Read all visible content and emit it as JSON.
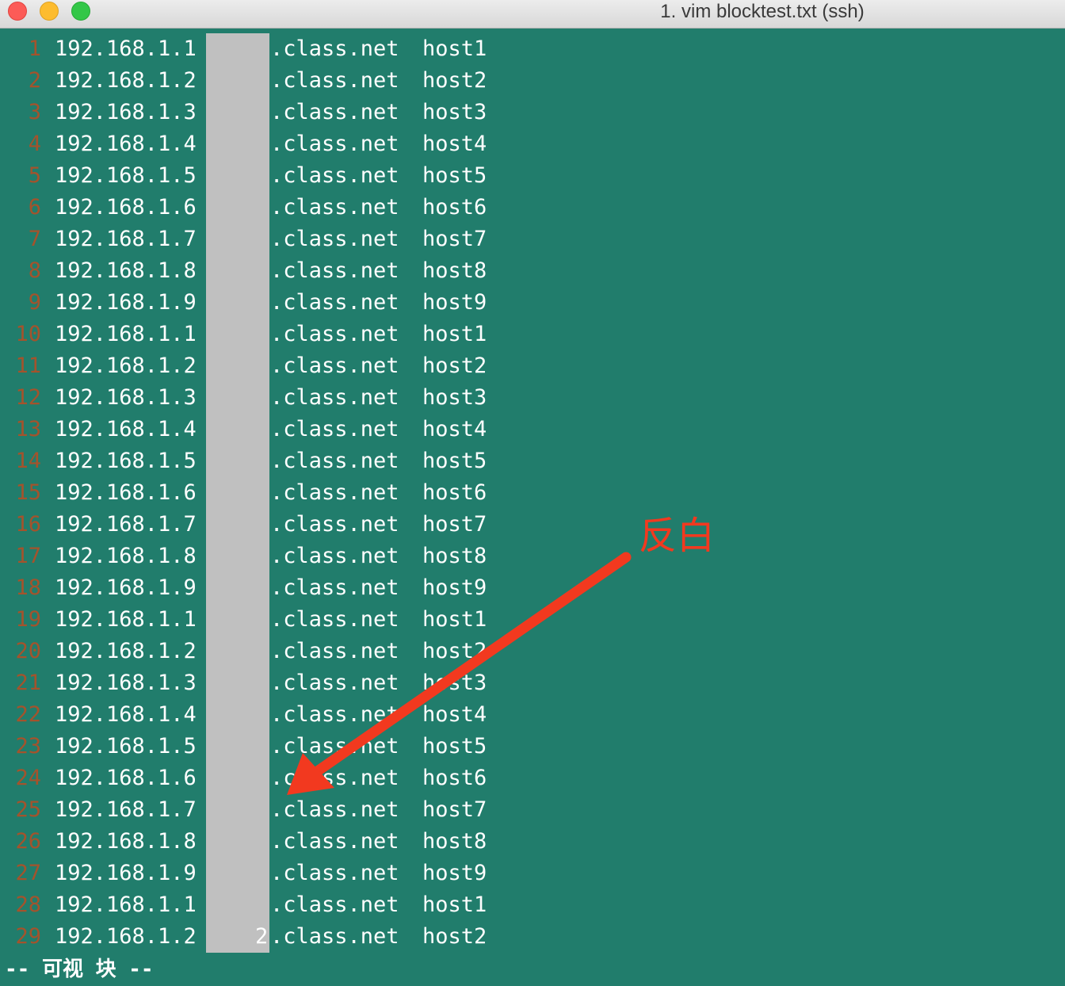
{
  "window": {
    "title": "1. vim blocktest.txt (ssh)"
  },
  "lines": [
    {
      "n": "1",
      "ip": "192.168.1.1",
      "domain": ".class.net",
      "host": "host1"
    },
    {
      "n": "2",
      "ip": "192.168.1.2",
      "domain": ".class.net",
      "host": "host2"
    },
    {
      "n": "3",
      "ip": "192.168.1.3",
      "domain": ".class.net",
      "host": "host3"
    },
    {
      "n": "4",
      "ip": "192.168.1.4",
      "domain": ".class.net",
      "host": "host4"
    },
    {
      "n": "5",
      "ip": "192.168.1.5",
      "domain": ".class.net",
      "host": "host5"
    },
    {
      "n": "6",
      "ip": "192.168.1.6",
      "domain": ".class.net",
      "host": "host6"
    },
    {
      "n": "7",
      "ip": "192.168.1.7",
      "domain": ".class.net",
      "host": "host7"
    },
    {
      "n": "8",
      "ip": "192.168.1.8",
      "domain": ".class.net",
      "host": "host8"
    },
    {
      "n": "9",
      "ip": "192.168.1.9",
      "domain": ".class.net",
      "host": "host9"
    },
    {
      "n": "10",
      "ip": "192.168.1.1",
      "domain": ".class.net",
      "host": "host1"
    },
    {
      "n": "11",
      "ip": "192.168.1.2",
      "domain": ".class.net",
      "host": "host2"
    },
    {
      "n": "12",
      "ip": "192.168.1.3",
      "domain": ".class.net",
      "host": "host3"
    },
    {
      "n": "13",
      "ip": "192.168.1.4",
      "domain": ".class.net",
      "host": "host4"
    },
    {
      "n": "14",
      "ip": "192.168.1.5",
      "domain": ".class.net",
      "host": "host5"
    },
    {
      "n": "15",
      "ip": "192.168.1.6",
      "domain": ".class.net",
      "host": "host6"
    },
    {
      "n": "16",
      "ip": "192.168.1.7",
      "domain": ".class.net",
      "host": "host7"
    },
    {
      "n": "17",
      "ip": "192.168.1.8",
      "domain": ".class.net",
      "host": "host8"
    },
    {
      "n": "18",
      "ip": "192.168.1.9",
      "domain": ".class.net",
      "host": "host9"
    },
    {
      "n": "19",
      "ip": "192.168.1.1",
      "domain": ".class.net",
      "host": "host1"
    },
    {
      "n": "20",
      "ip": "192.168.1.2",
      "domain": ".class.net",
      "host": "host2"
    },
    {
      "n": "21",
      "ip": "192.168.1.3",
      "domain": ".class.net",
      "host": "host3"
    },
    {
      "n": "22",
      "ip": "192.168.1.4",
      "domain": ".class.net",
      "host": "host4"
    },
    {
      "n": "23",
      "ip": "192.168.1.5",
      "domain": ".class.net",
      "host": "host5"
    },
    {
      "n": "24",
      "ip": "192.168.1.6",
      "domain": ".class.net",
      "host": "host6"
    },
    {
      "n": "25",
      "ip": "192.168.1.7",
      "domain": ".class.net",
      "host": "host7"
    },
    {
      "n": "26",
      "ip": "192.168.1.8",
      "domain": ".class.net",
      "host": "host8"
    },
    {
      "n": "27",
      "ip": "192.168.1.9",
      "domain": ".class.net",
      "host": "host9"
    },
    {
      "n": "28",
      "ip": "192.168.1.1",
      "domain": ".class.net",
      "host": "host1"
    },
    {
      "n": "29",
      "ip": "192.168.1.2",
      "domain": ".class.net",
      "host": "host2"
    }
  ],
  "cursor": {
    "count": "2"
  },
  "status": {
    "mode": "-- 可视 块 --"
  },
  "annotation": {
    "label": "反白",
    "color": "#f2391f"
  },
  "colors": {
    "background": "#217d6c",
    "line_number": "#a4532c",
    "selection": "#c0c0c0",
    "text": "#ffffff"
  }
}
